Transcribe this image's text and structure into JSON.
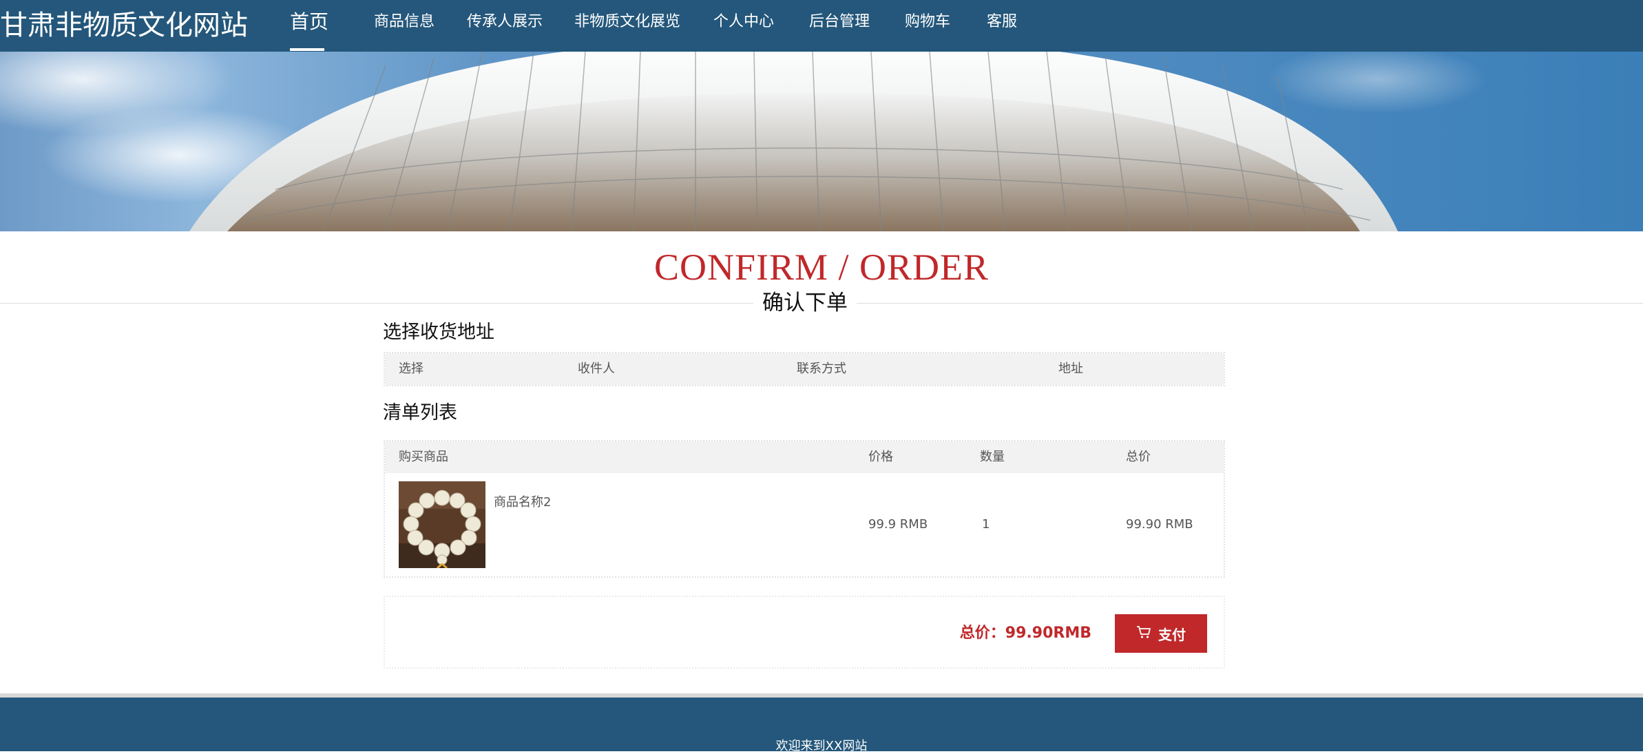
{
  "site": {
    "title": "甘肃非物质文化网站"
  },
  "nav": {
    "items": [
      {
        "label": "首页",
        "active": true
      },
      {
        "label": "商品信息"
      },
      {
        "label": "传承人展示"
      },
      {
        "label": "非物质文化展览"
      },
      {
        "label": "个人中心"
      },
      {
        "label": "后台管理"
      },
      {
        "label": "购物车"
      },
      {
        "label": "客服"
      }
    ]
  },
  "heading": {
    "en": "CONFIRM / ORDER",
    "cn": "确认下单"
  },
  "address": {
    "title": "选择收货地址",
    "columns": [
      "选择",
      "收件人",
      "联系方式",
      "地址"
    ]
  },
  "list": {
    "title": "清单列表",
    "columns": [
      "购买商品",
      "价格",
      "数量",
      "总价"
    ],
    "rows": [
      {
        "name": "商品名称2",
        "price": "99.9 RMB",
        "quantity": "1",
        "total": "99.90 RMB",
        "image": "bead-bracelet"
      }
    ]
  },
  "summary": {
    "total_label": "总价：99.90RMB",
    "pay_label": "支付",
    "pay_icon": "cart-icon"
  },
  "footer": {
    "text": "欢迎来到XX网站"
  },
  "colors": {
    "nav_bg": "#24577b",
    "accent": "#c0282a"
  }
}
